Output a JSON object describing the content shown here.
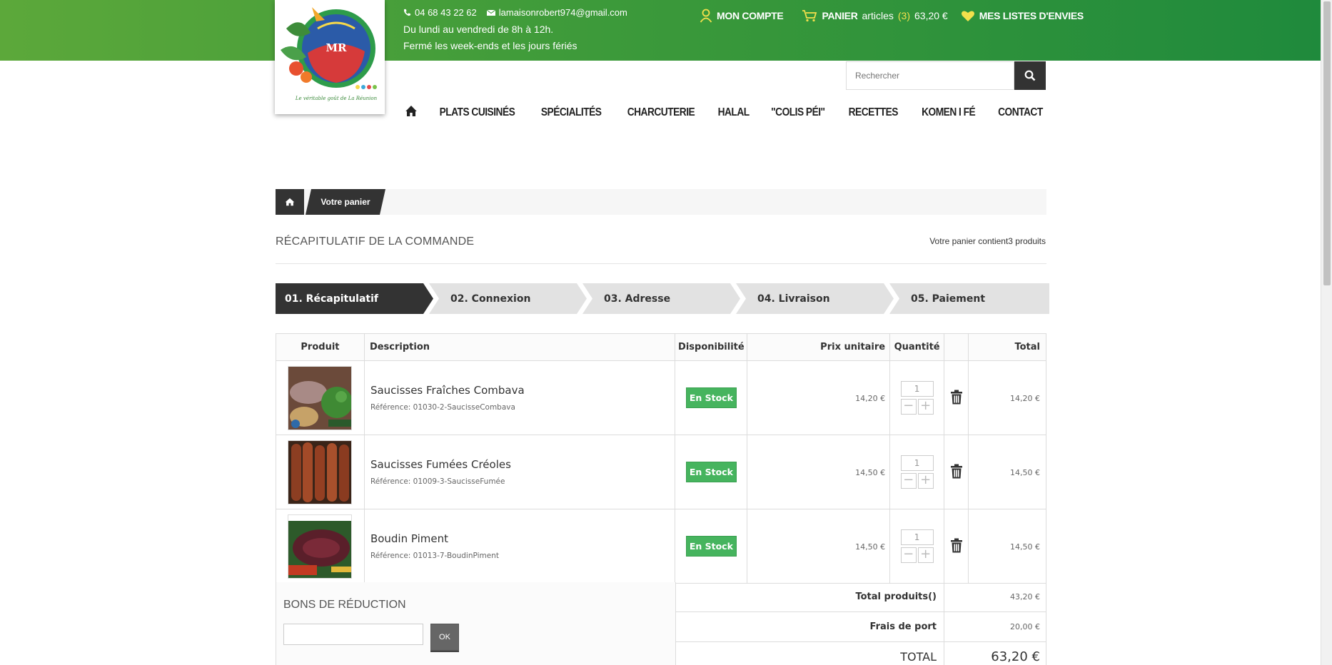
{
  "header": {
    "phone": "04 68 43 22 62",
    "email": "lamaisonrobert974@gmail.com",
    "hours": "Du lundi au vendredi de 8h à 12h.",
    "closed": "Fermé les week-ends et les jours fériés",
    "account_label": "MON COMPTE",
    "cart_label": "PANIER",
    "cart_articles": "articles",
    "cart_count": "(3)",
    "cart_total": "63,20 €",
    "wishlist_label": "MES LISTES D'ENVIES",
    "logo_text": "MR",
    "logo_tagline": "Le véritable goût de La Réunion"
  },
  "search": {
    "placeholder": "Rechercher"
  },
  "nav": {
    "items": [
      "PLATS CUISINÉS",
      "SPÉCIALITÉS",
      "CHARCUTERIE",
      "HALAL",
      "\"COLIS PÉI\"",
      "RECETTES",
      "KOMEN I FÉ",
      "CONTACT"
    ]
  },
  "breadcrumb": {
    "current": "Votre panier"
  },
  "summary": {
    "title": "RÉCAPITULATIF DE LA COMMANDE",
    "count": "Votre panier contient3 produits"
  },
  "steps": [
    "01. Récapitulatif",
    "02. Connexion",
    "03. Adresse",
    "04. Livraison",
    "05. Paiement"
  ],
  "table": {
    "headers": [
      "Produit",
      "Description",
      "Disponibilité",
      "Prix unitaire",
      "Quantité",
      "",
      "Total"
    ],
    "rows": [
      {
        "name": "Saucisses Fraîches Combava",
        "ref": "Référence: 01030-2-SaucisseCombava",
        "stock": "En Stock",
        "price": "14,20 €",
        "qty": "1",
        "total": "14,20 €"
      },
      {
        "name": "Saucisses Fumées Créoles",
        "ref": "Référence: 01009-3-SaucisseFumée",
        "stock": "En Stock",
        "price": "14,50 €",
        "qty": "1",
        "total": "14,50 €"
      },
      {
        "name": "Boudin Piment",
        "ref": "Référence: 01013-7-BoudinPiment",
        "stock": "En Stock",
        "price": "14,50 €",
        "qty": "1",
        "total": "14,50 €"
      }
    ]
  },
  "vouchers": {
    "title": "BONS DE RÉDUCTION",
    "ok_label": "OK"
  },
  "totals": [
    {
      "label": "Total produits()",
      "value": "43,20 €"
    },
    {
      "label": "Frais de port",
      "value": "20,00 €"
    },
    {
      "label": "TOTAL",
      "value": "63,20 €"
    }
  ],
  "colors": {
    "accent": "#3d9a3a",
    "dark": "#333333",
    "stock": "#46b45e",
    "highlight": "#f3e04c"
  }
}
